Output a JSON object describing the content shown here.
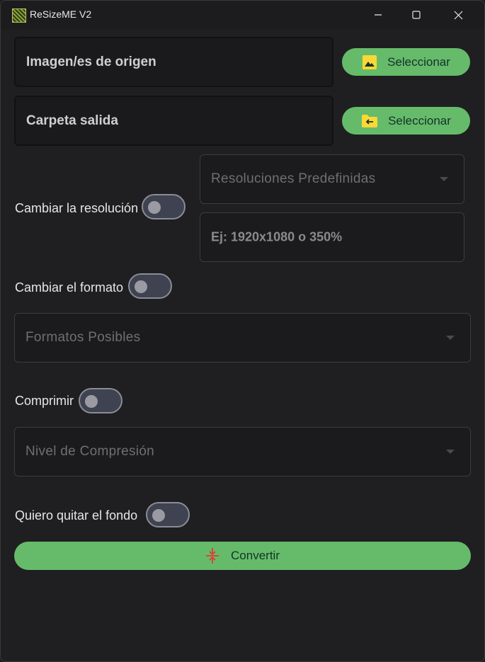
{
  "window": {
    "title": "ReSizeME V2",
    "app_icon": "resizeme-logo-icon",
    "controls": [
      "minimize-icon",
      "maximize-icon",
      "close-icon"
    ]
  },
  "source": {
    "label": "Imagen/es de origen",
    "button_label": "Seleccionar",
    "button_icon": "image-icon"
  },
  "output": {
    "label": "Carpeta salida",
    "button_label": "Seleccionar",
    "button_icon": "folder-arrow-icon"
  },
  "resolution": {
    "toggle_label": "Cambiar la resolución",
    "enabled": false,
    "preset_dropdown": "Resoluciones Predefinidas",
    "custom_placeholder": "Ej: 1920x1080 o 350%"
  },
  "format": {
    "toggle_label": "Cambiar el formato",
    "enabled": false,
    "dropdown": "Formatos Posibles"
  },
  "compress": {
    "toggle_label": "Comprimir",
    "enabled": false,
    "dropdown": "Nivel de Compresión"
  },
  "background": {
    "toggle_label": "Quiero quitar el fondo",
    "enabled": false
  },
  "convert": {
    "label": "Convertir",
    "icon": "compress-arrows-icon"
  },
  "colors": {
    "accent": "#66bb6a",
    "background": "#1f1f21",
    "icon_yellow": "#fdd835",
    "convert_icon": "#e53935"
  }
}
